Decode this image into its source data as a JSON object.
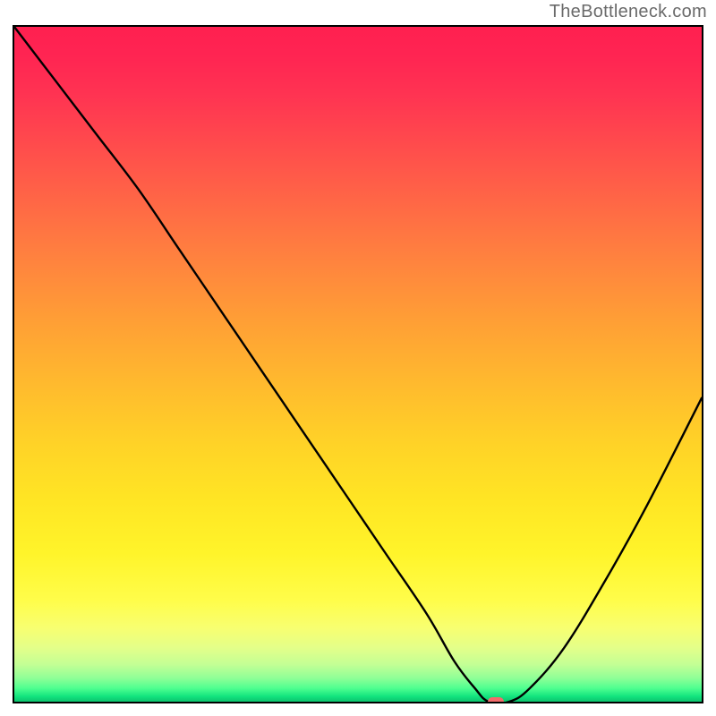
{
  "watermark": "TheBottleneck.com",
  "chart_data": {
    "type": "line",
    "title": "",
    "xlabel": "",
    "ylabel": "",
    "xlim": [
      0,
      100
    ],
    "ylim": [
      0,
      100
    ],
    "curve": {
      "name": "bottleneck-curve",
      "x": [
        0,
        6,
        12,
        18,
        24,
        30,
        36,
        42,
        48,
        54,
        60,
        64,
        67,
        69,
        72,
        75,
        80,
        86,
        92,
        100
      ],
      "y": [
        100,
        92,
        84,
        76,
        67,
        58,
        49,
        40,
        31,
        22,
        13,
        6,
        2,
        0,
        0,
        2,
        8,
        18,
        29,
        45
      ]
    },
    "marker": {
      "x": 70,
      "y": 0
    },
    "gradient": {
      "top_color": "#ff2050",
      "mid_color": "#ffe524",
      "bottom_color": "#0cc36e"
    }
  }
}
